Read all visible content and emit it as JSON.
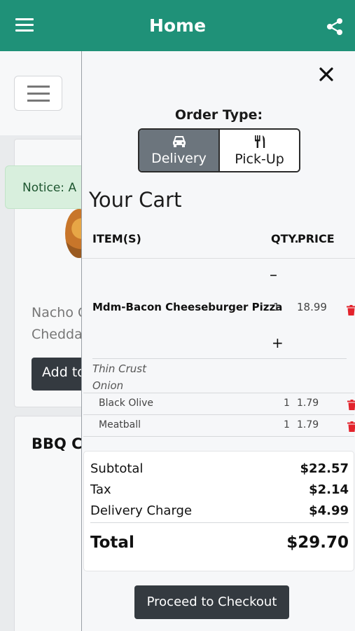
{
  "appbar": {
    "title": "Home",
    "menu_icon": "hamburger-menu-icon",
    "share_icon": "share-icon",
    "color": "#1f9178"
  },
  "background": {
    "notice_text": "Notice: A",
    "item_text_line1": "Nacho C",
    "item_text_line2": "Chedda",
    "add_button": "Add to",
    "card2_title": "BBQ C"
  },
  "drawer": {
    "order_type_label": "Order Type:",
    "order_types": [
      {
        "label": "Delivery",
        "icon": "car-icon",
        "active": true
      },
      {
        "label": "Pick-Up",
        "icon": "fork-knife-icon",
        "active": false
      }
    ],
    "cart_title": "Your Cart",
    "columns": {
      "items": "ITEM(S)",
      "qty": "QTY.",
      "price": "PRICE"
    },
    "item": {
      "name": "Mdm-Bacon Cheeseburger Pizza",
      "qty": "1",
      "price": "18.99",
      "decrement": "–",
      "increment": "+",
      "options": [
        "Thin Crust",
        "Onion"
      ]
    },
    "toppings": [
      {
        "name": "Black Olive",
        "qty": "1",
        "price": "1.79"
      },
      {
        "name": "Meatball",
        "qty": "1",
        "price": "1.79"
      }
    ],
    "totals": {
      "subtotal_label": "Subtotal",
      "subtotal": "$22.57",
      "tax_label": "Tax",
      "tax": "$2.14",
      "delivery_label": "Delivery Charge",
      "delivery": "$4.99",
      "total_label": "Total",
      "total": "$29.70"
    },
    "checkout_label": "Proceed to Checkout",
    "delete_color": "#e3232c"
  }
}
